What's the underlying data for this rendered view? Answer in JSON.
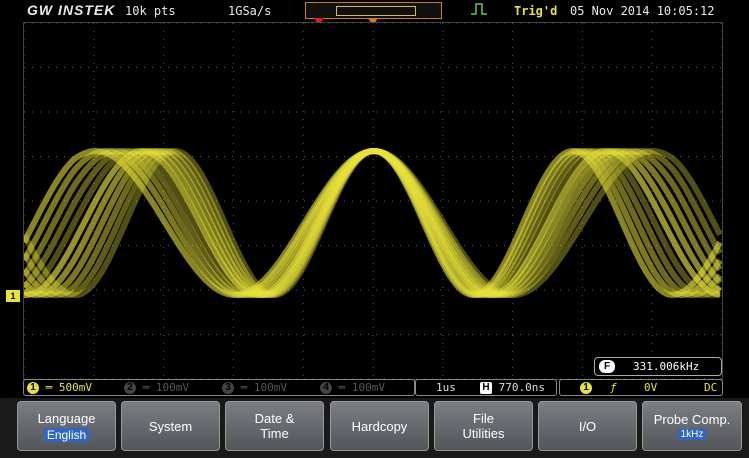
{
  "top_bar": {
    "brand": "GW INSTEK",
    "record_length": "10k pts",
    "sample_rate": "1GSa/s",
    "trigger_status": "Trig'd",
    "date_time": "05 Nov 2014 10:05:12"
  },
  "waveform": {
    "channel_marker": "1",
    "color": "#e8e23a"
  },
  "frequency_readout": {
    "icon_label": "F",
    "value": "331.006kHz"
  },
  "status_bar": {
    "channels": [
      {
        "num": "1",
        "scale": "500mV",
        "active": true
      },
      {
        "num": "2",
        "scale": "100mV",
        "active": false
      },
      {
        "num": "3",
        "scale": "100mV",
        "active": false
      },
      {
        "num": "4",
        "scale": "100mV",
        "active": false
      }
    ],
    "timebase": "1us",
    "position_icon": "H",
    "position": "770.0ns",
    "trigger_source": "1",
    "trigger_slope_icon": "rising-edge-icon",
    "trigger_level": "0V",
    "coupling": "DC"
  },
  "softkeys": [
    {
      "line1": "Language",
      "line2": "",
      "value": "English"
    },
    {
      "line1": "System",
      "line2": "",
      "value": ""
    },
    {
      "line1": "Date &",
      "line2": "Time",
      "value": ""
    },
    {
      "line1": "Hardcopy",
      "line2": "",
      "value": ""
    },
    {
      "line1": "File",
      "line2": "Utilities",
      "value": ""
    },
    {
      "line1": "I/O",
      "line2": "",
      "value": ""
    },
    {
      "line1": "Probe Comp.",
      "line2": "",
      "value": "1kHz"
    }
  ]
}
